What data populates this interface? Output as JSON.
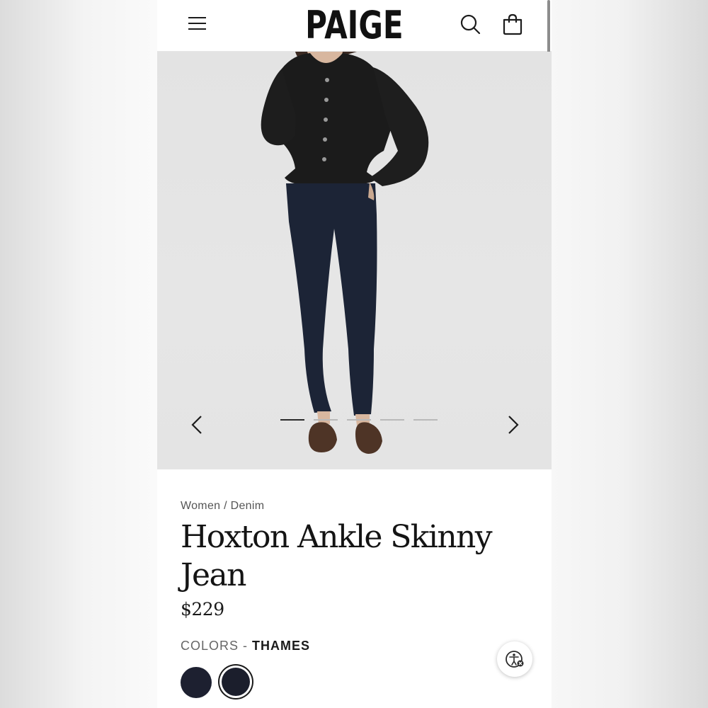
{
  "header": {
    "logo": "PAIGE",
    "menu_icon": "hamburger-menu-icon",
    "search_icon": "search-icon",
    "bag_icon": "shopping-bag-icon"
  },
  "gallery": {
    "slide_count": 5,
    "active_slide": 1,
    "prev_icon": "chevron-left-icon",
    "next_icon": "chevron-right-icon"
  },
  "product": {
    "breadcrumb": [
      "Women",
      "Denim"
    ],
    "breadcrumb_separator": "/",
    "title_line1": "Hoxton Ankle Skinny",
    "title_line2": "Jean",
    "price": "$229",
    "colors_label": "COLORS",
    "colors_separator": " - ",
    "selected_color": "THAMES",
    "swatches": [
      {
        "color": "#1d2030",
        "selected": false
      },
      {
        "color": "#1b1e2c",
        "selected": true
      }
    ]
  },
  "accessibility": {
    "icon": "accessibility-icon"
  }
}
